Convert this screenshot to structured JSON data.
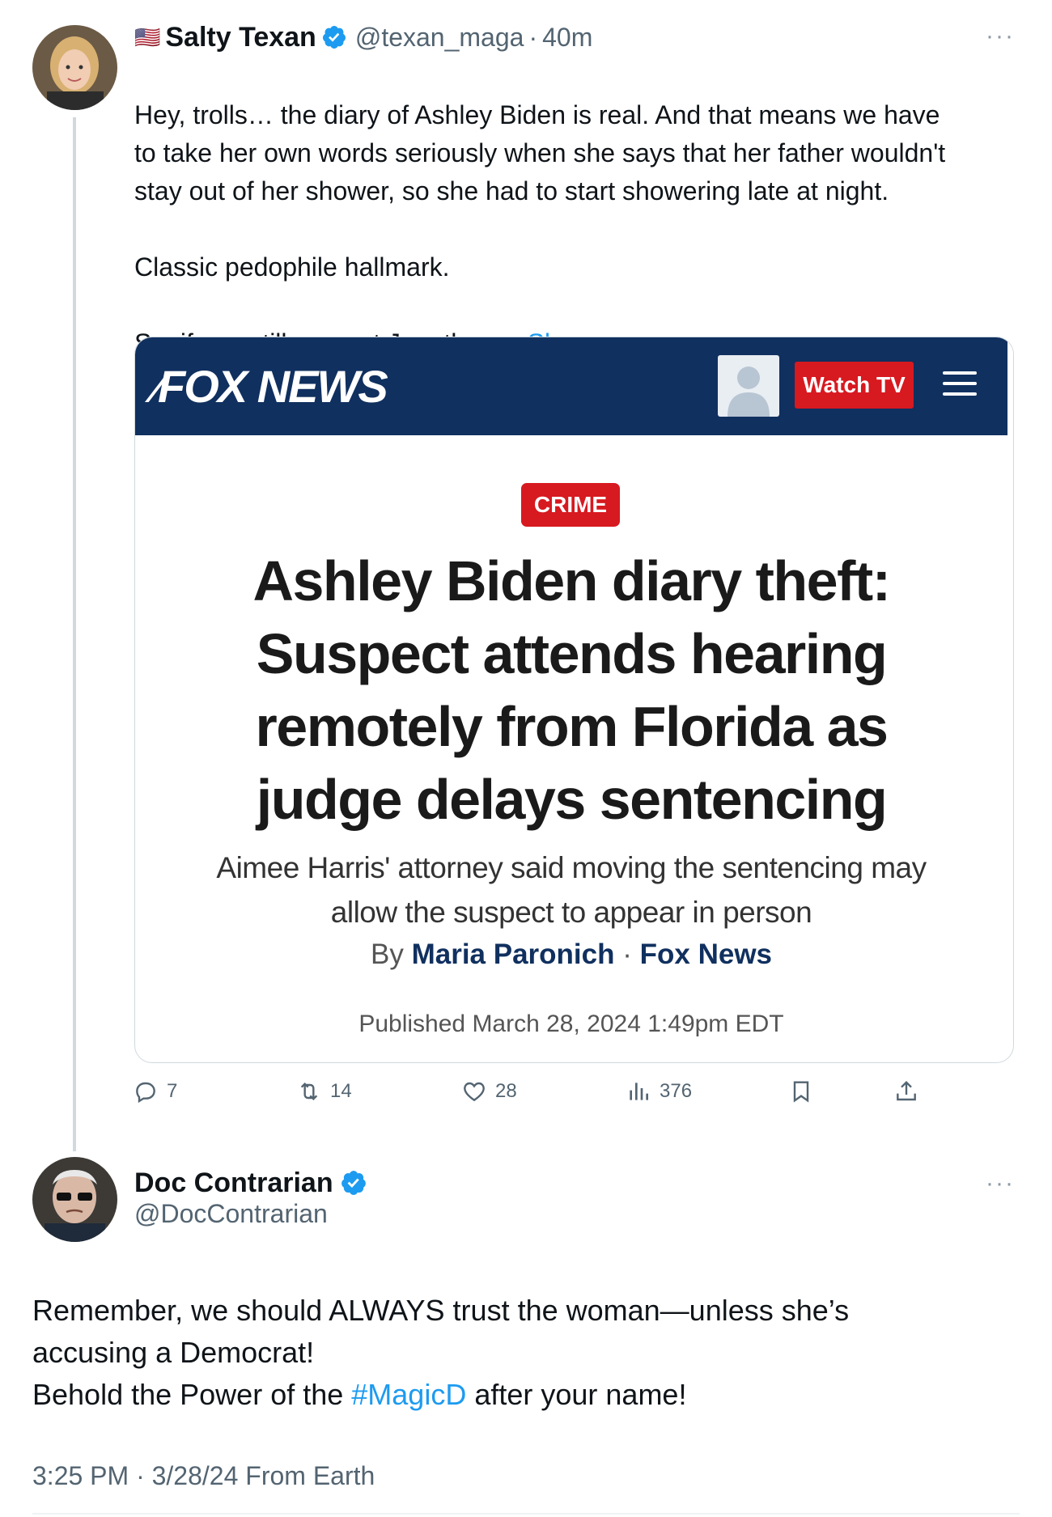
{
  "tweet1": {
    "flag": "🇺🇸",
    "name": "Salty Texan",
    "handle": "@texan_maga",
    "separator": "·",
    "time": "40m",
    "more": "···",
    "text_main": "Hey, trolls… the diary of Ashley Biden is real. And that means we have\nto take her own words seriously when she says that her father wouldn't\nstay out of her shower, so she had to start showering late at night.\n\nClassic pedophile hallmark.\n\nSo, if you still support Joe, then… ",
    "show_more": "Show more",
    "card": {
      "logo": "FOX NEWS",
      "watch_tv": "Watch TV",
      "category": "CRIME",
      "headline": "Ashley Biden diary theft: Suspect attends hearing remotely from Florida as judge delays sentencing",
      "subhead": "Aimee Harris' attorney said moving the sentencing may allow the suspect to appear in person",
      "by": "By",
      "author": "Maria Paronich",
      "dot": "·",
      "outlet": "Fox News",
      "published": "Published March 28, 2024 1:49pm EDT"
    },
    "actions": {
      "replies": "7",
      "reposts": "14",
      "likes": "28",
      "views": "376"
    }
  },
  "tweet2": {
    "name": "Doc Contrarian",
    "handle": "@DocContrarian",
    "more": "···",
    "text_line1": "Remember, we should ALWAYS trust the woman—unless she’s",
    "text_line2": "accusing a Democrat!",
    "text_line3_pre": "Behold the Power of the ",
    "hashtag": "#MagicD",
    "text_line3_post": " after your name!",
    "timestamp": "3:25 PM · 3/28/24 From Earth"
  },
  "colors": {
    "accent": "#1d9bf0",
    "fox_navy": "#10305f",
    "fox_red": "#d71920"
  }
}
